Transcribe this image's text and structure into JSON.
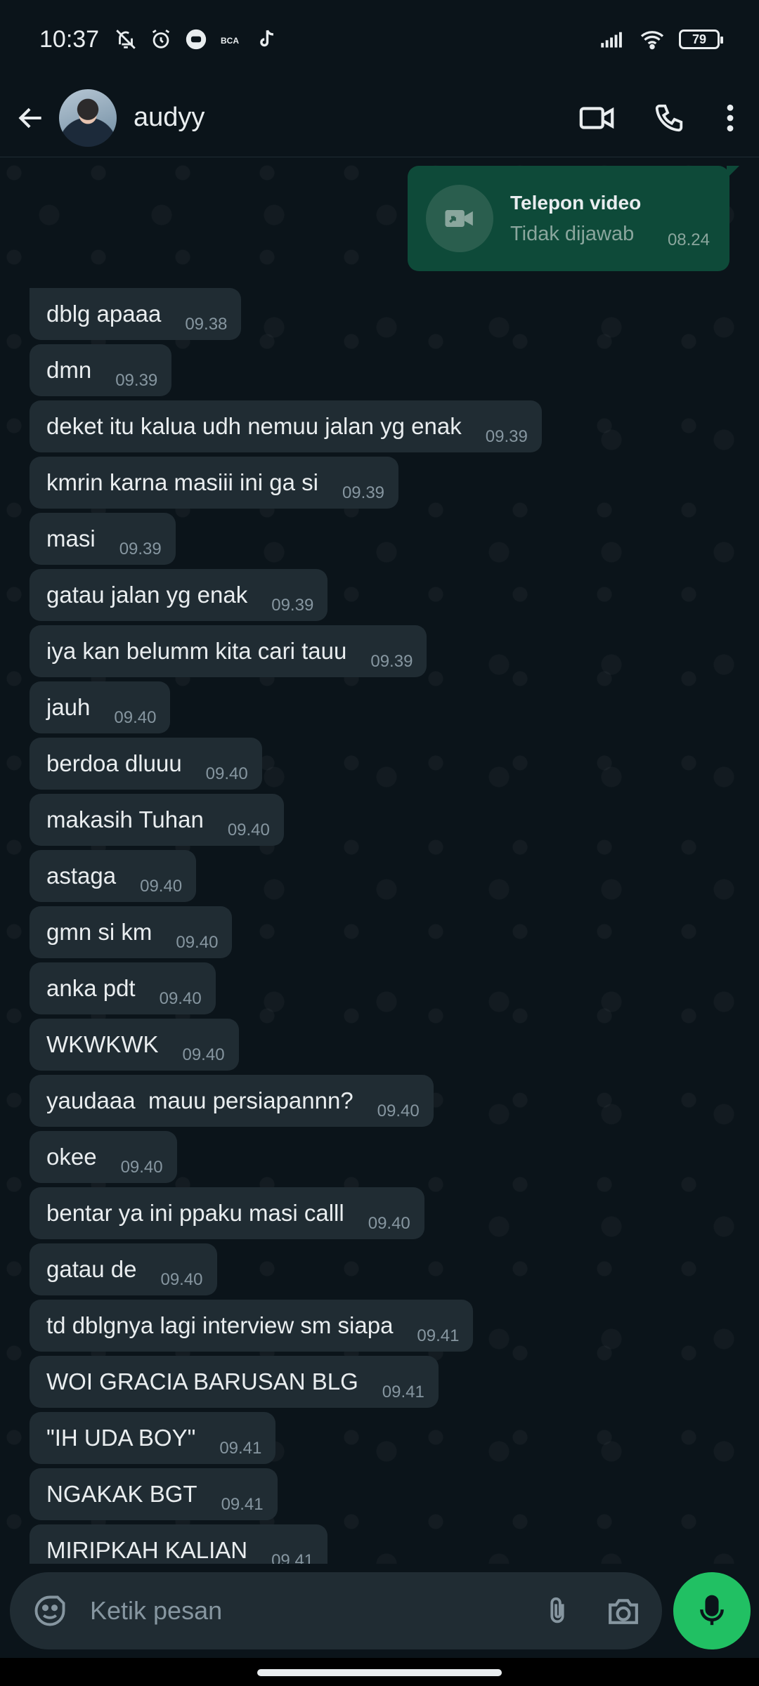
{
  "status_bar": {
    "time": "10:37",
    "battery": "79"
  },
  "header": {
    "contact_name": "audyy"
  },
  "call_bubble": {
    "title": "Telepon video",
    "status": "Tidak dijawab",
    "time": "08.24"
  },
  "messages": [
    {
      "text": "dblg apaaa",
      "time": "09.38"
    },
    {
      "text": "dmn",
      "time": "09.39"
    },
    {
      "text": "deket itu kalua udh nemuu jalan yg enak",
      "time": "09.39"
    },
    {
      "text": "kmrin karna masiii ini ga si",
      "time": "09.39"
    },
    {
      "text": "masi",
      "time": "09.39"
    },
    {
      "text": "gatau jalan yg enak",
      "time": "09.39"
    },
    {
      "text": "iya kan belumm kita cari tauu",
      "time": "09.39"
    },
    {
      "text": "jauh",
      "time": "09.40"
    },
    {
      "text": "berdoa dluuu",
      "time": "09.40"
    },
    {
      "text": "makasih Tuhan",
      "time": "09.40"
    },
    {
      "text": "astaga",
      "time": "09.40"
    },
    {
      "text": "gmn si km",
      "time": "09.40"
    },
    {
      "text": "anka pdt",
      "time": "09.40"
    },
    {
      "text": "WKWKWK",
      "time": "09.40"
    },
    {
      "text": "yaudaaa  mauu persiapannn?",
      "time": "09.40"
    },
    {
      "text": "okee",
      "time": "09.40"
    },
    {
      "text": "bentar ya ini ppaku masi calll",
      "time": "09.40"
    },
    {
      "text": "gatau de",
      "time": "09.40"
    },
    {
      "text": "td dblgnya lagi interview sm siapa",
      "time": "09.41"
    },
    {
      "text": "WOI GRACIA BARUSAN BLG",
      "time": "09.41"
    },
    {
      "text": "\"IH UDA BOY\"",
      "time": "09.41"
    },
    {
      "text": "NGAKAK BGT",
      "time": "09.41"
    },
    {
      "text": "MIRIPKAH KALIAN",
      "time": "09.41"
    }
  ],
  "composer": {
    "placeholder": "Ketik pesan"
  },
  "colors": {
    "incoming_bubble": "#202c33",
    "outgoing_bubble": "#0e4a39",
    "accent_green": "#21c063",
    "background": "#0b141a"
  }
}
